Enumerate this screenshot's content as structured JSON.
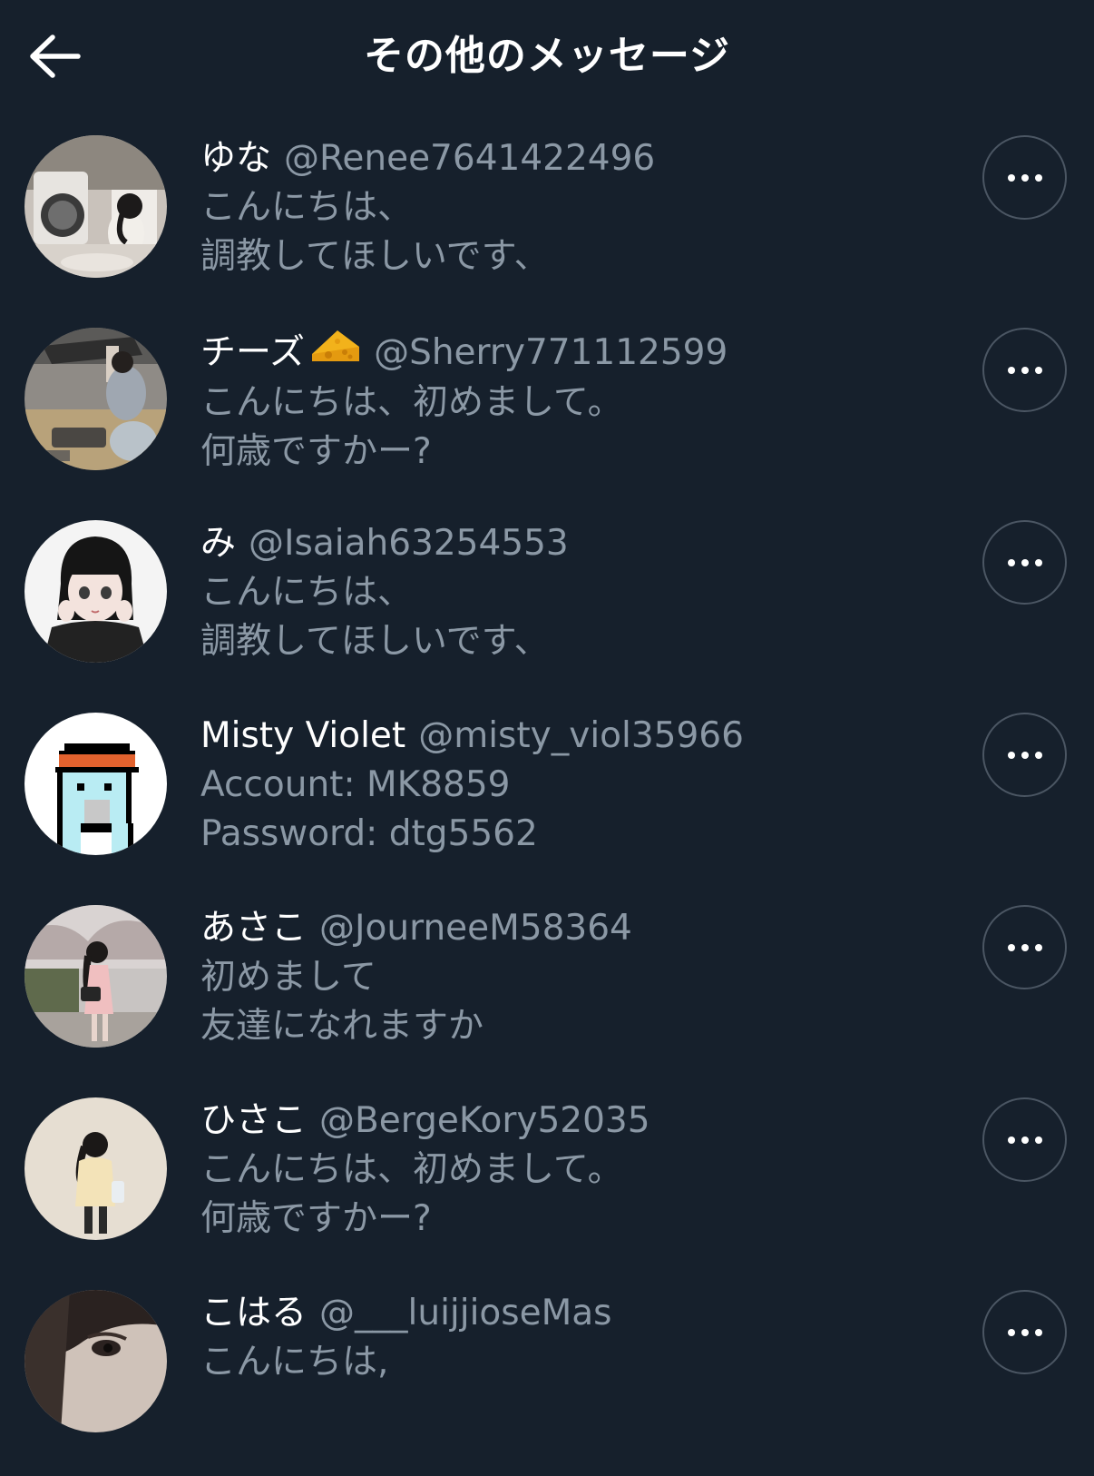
{
  "header": {
    "title": "その他のメッセージ",
    "back_icon": "arrow-left-icon"
  },
  "conversations": [
    {
      "name": "ゆな",
      "handle": "@Renee7641422496",
      "lines": [
        "こんにちは、",
        "調教してほしいです、"
      ],
      "avatar_icon": "photo-avatar"
    },
    {
      "name": "チーズ",
      "emoji_icon": "cheese-emoji-icon",
      "handle": "@Sherry771112599",
      "lines": [
        "こんにちは、初めまして。",
        "何歳ですかー?"
      ],
      "avatar_icon": "photo-avatar"
    },
    {
      "name": "み",
      "handle": "@Isaiah63254553",
      "lines": [
        "こんにちは、",
        "調教してほしいです、"
      ],
      "avatar_icon": "illustration-avatar"
    },
    {
      "name": "Misty Violet",
      "handle": "@misty_viol35966",
      "lines": [
        "Account: MK8859",
        "Password: dtg5562"
      ],
      "avatar_icon": "pixel-art-avatar"
    },
    {
      "name": "あさこ",
      "handle": "@JourneeM58364",
      "lines": [
        "初めまして",
        "友達になれますか"
      ],
      "avatar_icon": "photo-avatar"
    },
    {
      "name": "ひさこ",
      "handle": "@BergeKory52035",
      "lines": [
        "こんにちは、初めまして。",
        "何歳ですかー?"
      ],
      "avatar_icon": "photo-avatar"
    },
    {
      "name": "こはる",
      "handle": "@___luijjioseMas",
      "lines": [
        "こんにちは,"
      ],
      "avatar_icon": "photo-avatar"
    }
  ],
  "more_icon": "more-horizontal-icon",
  "colors": {
    "background": "#16202c",
    "primary_text": "#ffffff",
    "secondary_text": "#8b98a5",
    "button_border": "#4b5663"
  }
}
